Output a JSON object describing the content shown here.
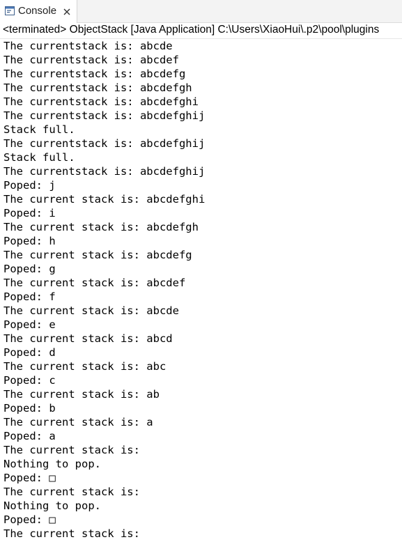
{
  "tab": {
    "label": "Console",
    "icon": "console-icon",
    "close_icon": "close-icon"
  },
  "status": {
    "text": "<terminated> ObjectStack [Java Application] C:\\Users\\XiaoHui\\.p2\\pool\\plugins"
  },
  "console": {
    "lines": [
      "The currentstack is: abcde",
      "The currentstack is: abcdef",
      "The currentstack is: abcdefg",
      "The currentstack is: abcdefgh",
      "The currentstack is: abcdefghi",
      "The currentstack is: abcdefghij",
      "Stack full.",
      "The currentstack is: abcdefghij",
      "Stack full.",
      "The currentstack is: abcdefghij",
      "Poped: j",
      "The current stack is: abcdefghi",
      "Poped: i",
      "The current stack is: abcdefgh",
      "Poped: h",
      "The current stack is: abcdefg",
      "Poped: g",
      "The current stack is: abcdef",
      "Poped: f",
      "The current stack is: abcde",
      "Poped: e",
      "The current stack is: abcd",
      "Poped: d",
      "The current stack is: abc",
      "Poped: c",
      "The current stack is: ab",
      "Poped: b",
      "The current stack is: a",
      "Poped: a",
      "The current stack is: ",
      "Nothing to pop.",
      "Poped: □",
      "The current stack is: ",
      "Nothing to pop.",
      "Poped: □",
      "The current stack is: "
    ]
  }
}
